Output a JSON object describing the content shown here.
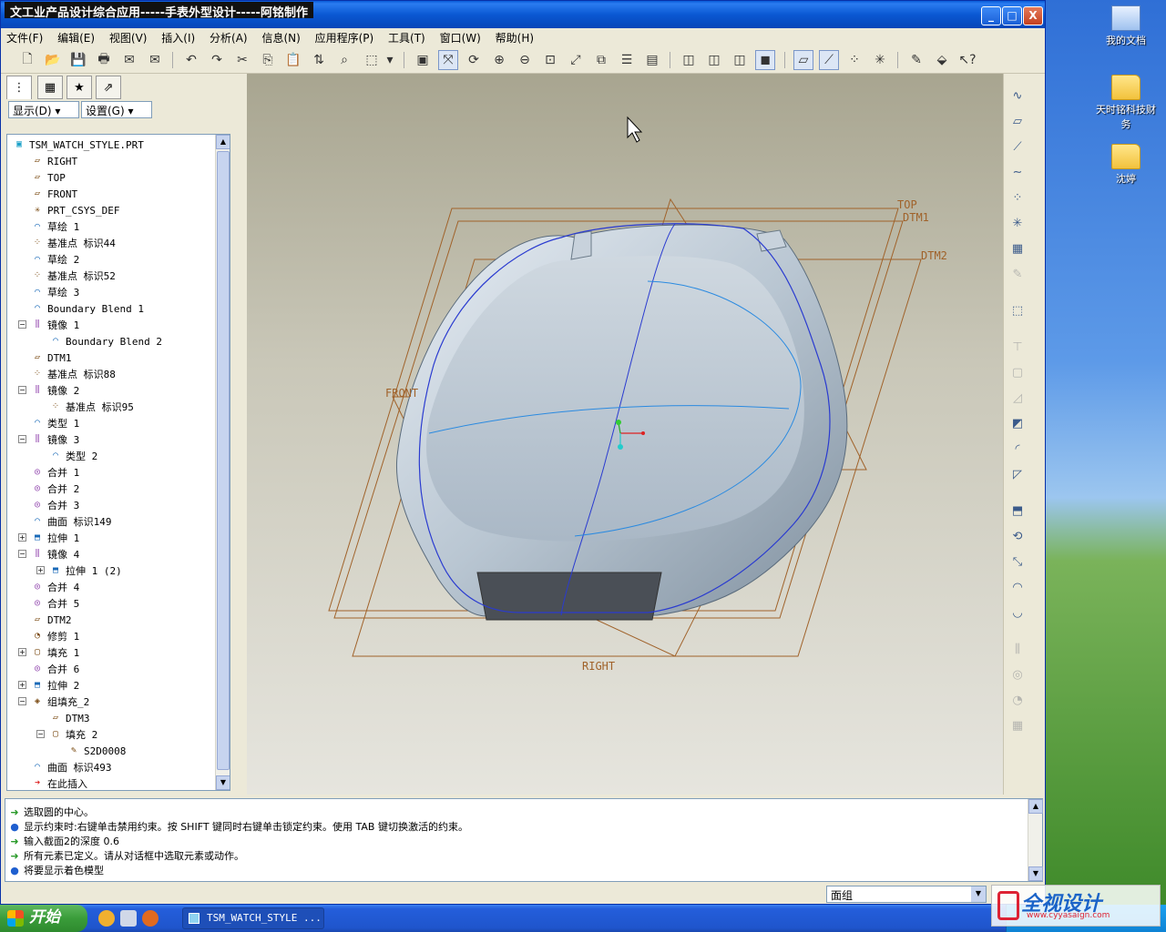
{
  "window": {
    "title": "文工业产品设计综合应用-----手表外型设计-----阿铭制作",
    "min_label": "_",
    "max_label": "□",
    "close_label": "X"
  },
  "menu": [
    "文件(F)",
    "编辑(E)",
    "视图(V)",
    "插入(I)",
    "分析(A)",
    "信息(N)",
    "应用程序(P)",
    "工具(T)",
    "窗口(W)",
    "帮助(H)"
  ],
  "panel": {
    "show_button": "显示(D) ▾",
    "settings_button": "设置(G) ▾"
  },
  "tree": [
    {
      "label": "TSM_WATCH_STYLE.PRT",
      "icon": "part-icon"
    },
    {
      "label": "RIGHT",
      "icon": "datum-plane-icon"
    },
    {
      "label": "TOP",
      "icon": "datum-plane-icon"
    },
    {
      "label": "FRONT",
      "icon": "datum-plane-icon"
    },
    {
      "label": "PRT_CSYS_DEF",
      "icon": "csys-icon"
    },
    {
      "label": "草绘 1",
      "icon": "sketch-icon"
    },
    {
      "label": "基准点 标识44",
      "icon": "datum-point-icon"
    },
    {
      "label": "草绘 2",
      "icon": "sketch-icon"
    },
    {
      "label": "基准点 标识52",
      "icon": "datum-point-icon"
    },
    {
      "label": "草绘 3",
      "icon": "sketch-icon"
    },
    {
      "label": "Boundary Blend 1",
      "icon": "boundary-blend-icon"
    },
    {
      "label": "镜像 1",
      "icon": "mirror-icon"
    },
    {
      "label": "Boundary Blend 2",
      "icon": "boundary-blend-icon"
    },
    {
      "label": "DTM1",
      "icon": "datum-plane-icon"
    },
    {
      "label": "基准点 标识88",
      "icon": "datum-point-icon"
    },
    {
      "label": "镜像 2",
      "icon": "mirror-icon"
    },
    {
      "label": "基准点 标识95",
      "icon": "datum-point-icon"
    },
    {
      "label": "类型 1",
      "icon": "surface-icon"
    },
    {
      "label": "镜像 3",
      "icon": "mirror-icon"
    },
    {
      "label": "类型 2",
      "icon": "surface-icon"
    },
    {
      "label": "合并 1",
      "icon": "merge-icon"
    },
    {
      "label": "合并 2",
      "icon": "merge-icon"
    },
    {
      "label": "合并 3",
      "icon": "merge-icon"
    },
    {
      "label": "曲面 标识149",
      "icon": "surface-icon"
    },
    {
      "label": "拉伸 1",
      "icon": "extrude-icon"
    },
    {
      "label": "镜像 4",
      "icon": "mirror-icon"
    },
    {
      "label": "拉伸 1 (2)",
      "icon": "extrude-icon"
    },
    {
      "label": "合并 4",
      "icon": "merge-icon"
    },
    {
      "label": "合并 5",
      "icon": "merge-icon"
    },
    {
      "label": "DTM2",
      "icon": "datum-plane-icon"
    },
    {
      "label": "修剪 1",
      "icon": "trim-icon"
    },
    {
      "label": "填充 1",
      "icon": "fill-icon"
    },
    {
      "label": "合并 6",
      "icon": "merge-icon"
    },
    {
      "label": "拉伸 2",
      "icon": "extrude-icon"
    },
    {
      "label": "组填充_2",
      "icon": "group-icon"
    },
    {
      "label": "DTM3",
      "icon": "datum-plane-icon"
    },
    {
      "label": "填充 2",
      "icon": "fill-icon"
    },
    {
      "label": "S2D0008",
      "icon": "sketch-section-icon"
    },
    {
      "label": "曲面 标识493",
      "icon": "surface-icon"
    },
    {
      "label": "在此插入",
      "icon": "insert-here-icon"
    }
  ],
  "viewport_labels": {
    "top": "TOP",
    "dtm1": "DTM1",
    "dtm2": "DTM2",
    "front": "FRONT",
    "right": "RIGHT"
  },
  "messages": [
    {
      "type": "prompt",
      "text": "选取圆的中心。"
    },
    {
      "type": "info",
      "text": "显示约束时:右键单击禁用约束。按 SHIFT 键同时右键单击锁定约束。使用 TAB 键切换激活的约束。"
    },
    {
      "type": "prompt",
      "text": "输入截面2的深度   0.6"
    },
    {
      "type": "prompt",
      "text": "所有元素已定义。请从对话框中选取元素或动作。"
    },
    {
      "type": "info",
      "text": "将要显示着色模型"
    }
  ],
  "status": {
    "filter": "面组"
  },
  "taskbar": {
    "start": "开始",
    "task": "TSM_WATCH_STYLE ..."
  },
  "desktop_icons": [
    "我的文档",
    "天时铭科技财务",
    "沈婷"
  ],
  "watermark": {
    "brand": "全视设计",
    "url": "www.cyyasaign.com"
  }
}
